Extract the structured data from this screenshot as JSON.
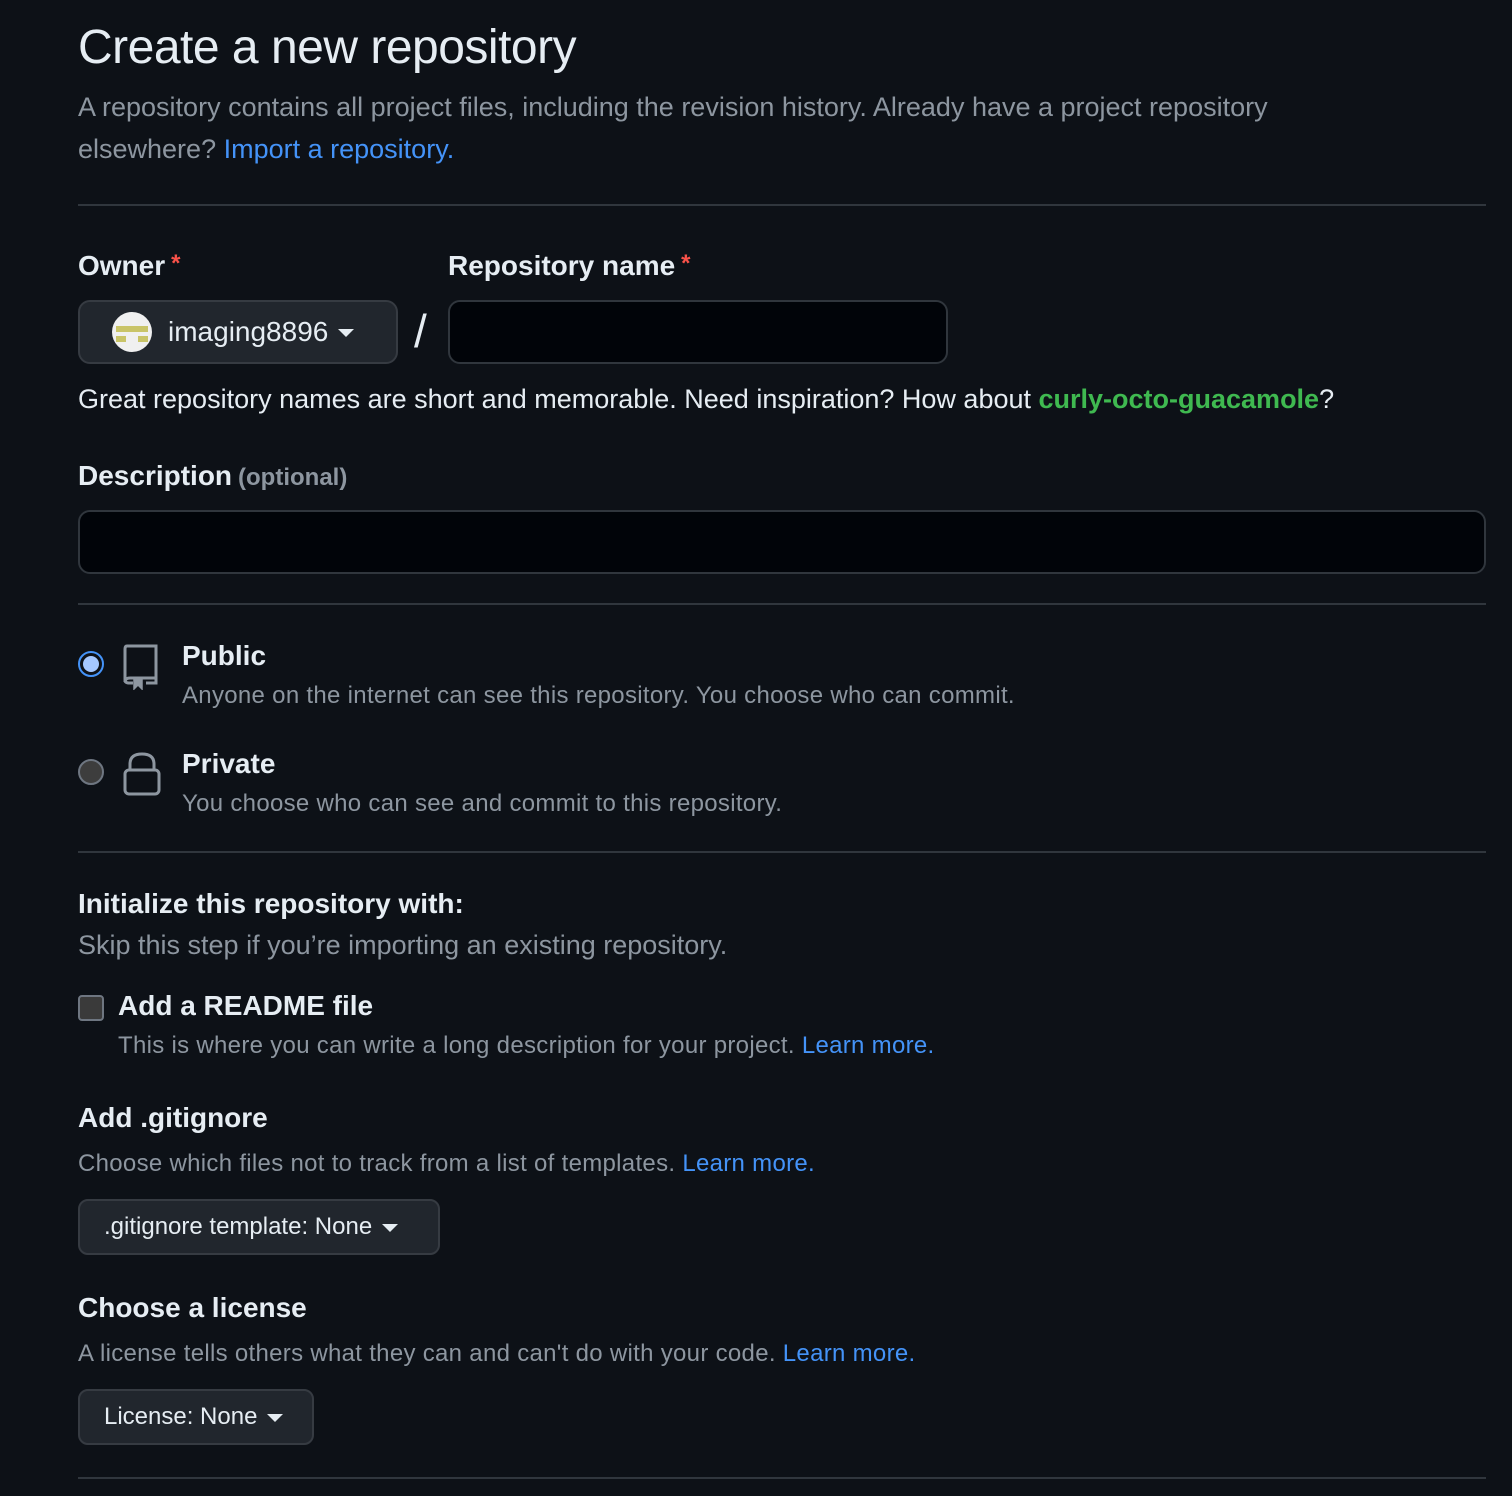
{
  "header": {
    "title": "Create a new repository",
    "subtitle_text": "A repository contains all project files, including the revision history. Already have a project repository elsewhere?",
    "import_link": "Import a repository."
  },
  "owner": {
    "label": "Owner",
    "required_mark": "*",
    "value": "imaging8896"
  },
  "repo_name": {
    "label": "Repository name",
    "required_mark": "*",
    "value": "",
    "separator": "/"
  },
  "name_hint": {
    "text": "Great repository names are short and memorable. Need inspiration? How about",
    "suggestion": "curly-octo-guacamole",
    "suffix": "?"
  },
  "description": {
    "label": "Description",
    "optional": "(optional)",
    "value": ""
  },
  "visibility": {
    "selected": "public",
    "options": [
      {
        "id": "public",
        "title": "Public",
        "desc": "Anyone on the internet can see this repository. You choose who can commit.",
        "icon": "repo-icon"
      },
      {
        "id": "private",
        "title": "Private",
        "desc": "You choose who can see and commit to this repository.",
        "icon": "lock-icon"
      }
    ]
  },
  "initialize": {
    "title": "Initialize this repository with:",
    "subtitle": "Skip this step if you’re importing an existing repository.",
    "readme": {
      "checked": false,
      "label": "Add a README file",
      "desc": "This is where you can write a long description for your project.",
      "link": "Learn more."
    }
  },
  "gitignore": {
    "title": "Add .gitignore",
    "desc": "Choose which files not to track from a list of templates.",
    "link": "Learn more.",
    "select_label": ".gitignore template: None"
  },
  "license": {
    "title": "Choose a license",
    "desc": "A license tells others what they can and can't do with your code.",
    "link": "Learn more.",
    "select_label": "License: None"
  },
  "colors": {
    "background": "#0d1117",
    "accent_link": "#4493f8",
    "suggestion_green": "#3fb950",
    "required_red": "#f85149"
  }
}
